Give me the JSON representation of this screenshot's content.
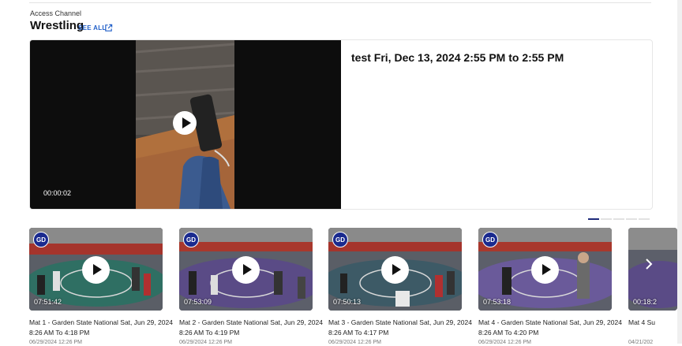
{
  "channel": {
    "eyebrow": "Access Channel",
    "title": "Wrestling",
    "see_all": "SEE ALL"
  },
  "featured": {
    "title": "test Fri, Dec 13, 2024 2:55 PM to 2:55 PM",
    "duration": "00:00:02"
  },
  "carousel": {
    "active_page": 1,
    "page_count": 5
  },
  "cards": [
    {
      "badge": "GD",
      "duration": "07:51:42",
      "title": "Mat 1 - Garden State National Sat, Jun 29, 2024",
      "time_range": "8:26 AM To 4:18 PM",
      "date": "06/29/2024 12:26 PM"
    },
    {
      "badge": "GD",
      "duration": "07:53:09",
      "title": "Mat 2 - Garden State National Sat, Jun 29, 2024",
      "time_range": "8:26 AM To 4:19 PM",
      "date": "06/29/2024 12:26 PM"
    },
    {
      "badge": "GD",
      "duration": "07:50:13",
      "title": "Mat 3 - Garden State National Sat, Jun 29, 2024",
      "time_range": "8:26 AM To 4:17 PM",
      "date": "06/29/2024 12:26 PM"
    },
    {
      "badge": "GD",
      "duration": "07:53:18",
      "title": "Mat 4 - Garden State National Sat, Jun 29, 2024",
      "time_range": "8:26 AM To 4:20 PM",
      "date": "06/29/2024 12:26 PM"
    },
    {
      "badge": "",
      "duration": "00:18:2",
      "title": "Mat 4 Su",
      "time_range": "",
      "date": "04/21/202"
    }
  ],
  "colors": {
    "link": "#2260c9",
    "badge": "#1a2a8e",
    "dot_active": "#1e2a7a"
  },
  "icons": [
    "external-link-icon",
    "play-icon",
    "chevron-right-icon"
  ]
}
